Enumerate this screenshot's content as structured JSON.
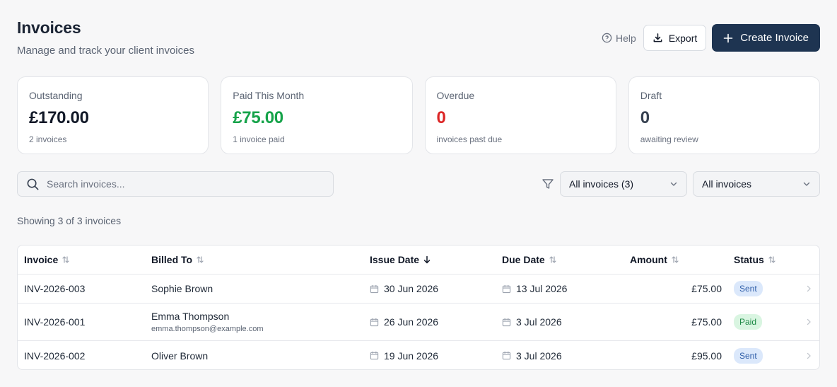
{
  "header": {
    "title": "Invoices",
    "subtitle": "Manage and track your client invoices"
  },
  "actions": {
    "help_label": "Help",
    "export_label": "Export",
    "create_label": "Create Invoice"
  },
  "stats": [
    {
      "label": "Outstanding",
      "value": "£170.00",
      "note": "2 invoices",
      "color": "#111827"
    },
    {
      "label": "Paid This Month",
      "value": "£75.00",
      "note": "1 invoice paid",
      "color": "#16a34a"
    },
    {
      "label": "Overdue",
      "value": "0",
      "note": "invoices past due",
      "color": "#dc2626"
    },
    {
      "label": "Draft",
      "value": "0",
      "note": "awaiting review",
      "color": "#374151"
    }
  ],
  "search": {
    "placeholder": "Search invoices...",
    "value": ""
  },
  "filters": {
    "status_selected": "All invoices (3)",
    "period_selected": "All invoices"
  },
  "showing_text": "Showing 3 of 3 invoices",
  "table": {
    "headers": {
      "invoice": "Invoice",
      "billed_to": "Billed To",
      "issue_date": "Issue Date",
      "due_date": "Due Date",
      "amount": "Amount",
      "status": "Status"
    },
    "rows": [
      {
        "invoice": "INV-2026-003",
        "name": "Sophie Brown",
        "email": "",
        "issue": "30 Jun 2026",
        "due": "13 Jul 2026",
        "amount": "£75.00",
        "status": "Sent"
      },
      {
        "invoice": "INV-2026-001",
        "name": "Emma Thompson",
        "email": "emma.thompson@example.com",
        "issue": "26 Jun 2026",
        "due": "3 Jul 2026",
        "amount": "£75.00",
        "status": "Paid"
      },
      {
        "invoice": "INV-2026-002",
        "name": "Oliver Brown",
        "email": "",
        "issue": "19 Jun 2026",
        "due": "3 Jul 2026",
        "amount": "£95.00",
        "status": "Sent"
      }
    ]
  },
  "icons": {
    "help": "help-circle-icon",
    "export": "download-icon",
    "create": "plus-icon",
    "search": "search-icon",
    "filter": "filter-icon",
    "sort": "sort-icon",
    "sort_active": "arrow-down-icon",
    "calendar": "calendar-icon",
    "chevron_down": "chevron-down-icon",
    "chevron_right": "chevron-right-icon"
  },
  "colors": {
    "brand": "#1e3451",
    "sent_badge": "#dbe8fb",
    "paid_badge": "#d9f5e1"
  }
}
